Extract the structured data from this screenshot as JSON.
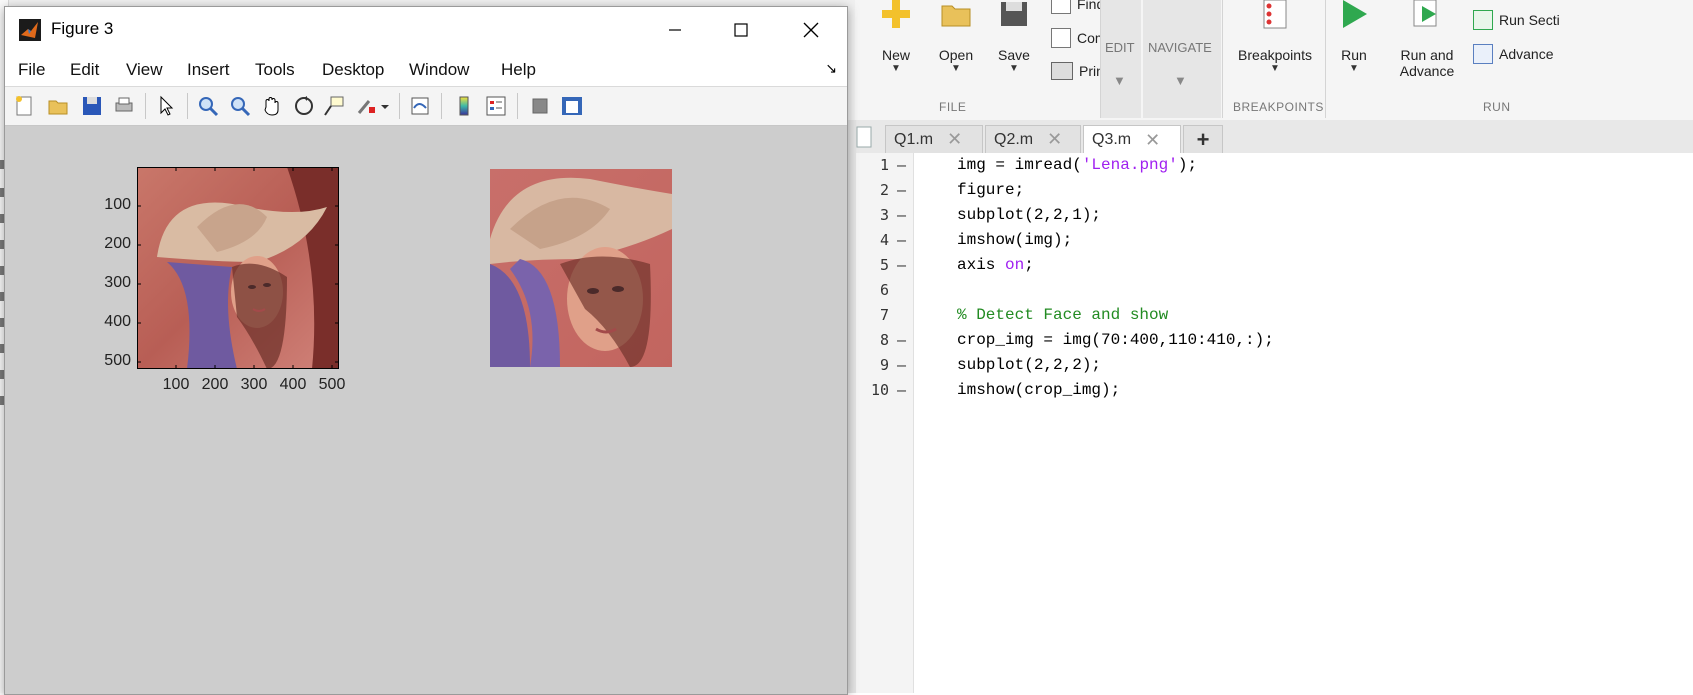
{
  "figure": {
    "title": "Figure 3",
    "menus": [
      "File",
      "Edit",
      "View",
      "Insert",
      "Tools",
      "Desktop",
      "Window",
      "Help"
    ],
    "toolbar_icons": [
      "new-figure-icon",
      "open-file-icon",
      "save-icon",
      "print-icon",
      "pointer-icon",
      "zoom-in-icon",
      "zoom-out-icon",
      "pan-hand-icon",
      "rotate-3d-icon",
      "data-cursor-icon",
      "brush-icon",
      "link-plot-icon",
      "colorbar-icon",
      "legend-icon",
      "hide-plot-tools-icon",
      "show-plot-tools-icon"
    ],
    "subplot1": {
      "yticks": [
        "100",
        "200",
        "300",
        "400",
        "500"
      ],
      "xticks": [
        "100",
        "200",
        "300",
        "400",
        "500"
      ]
    }
  },
  "toolstrip": {
    "new_label": "New",
    "open_label": "Open",
    "save_label": "Save",
    "find_files_label": "Find Files",
    "compare_label": "Compare",
    "print_label": "Print",
    "edit_label": "EDIT",
    "navigate_label": "NAVIGATE",
    "breakpoints_label": "Breakpoints",
    "run_label": "Run",
    "run_advance_label_1": "Run and",
    "run_advance_label_2": "Advance",
    "run_section_label": "Run Secti",
    "advance_label": "Advance",
    "sections": {
      "file": "FILE",
      "breakpoints": "BREAKPOINTS",
      "run": "RUN"
    }
  },
  "editor": {
    "tabs": [
      {
        "label": "Q1.m",
        "active": false
      },
      {
        "label": "Q2.m",
        "active": false
      },
      {
        "label": "Q3.m",
        "active": true
      }
    ],
    "add_tab": "+",
    "lines": [
      {
        "n": "1",
        "dash": "–"
      },
      {
        "n": "2",
        "dash": "–"
      },
      {
        "n": "3",
        "dash": "–"
      },
      {
        "n": "4",
        "dash": "–"
      },
      {
        "n": "5",
        "dash": "–"
      },
      {
        "n": "6",
        "dash": ""
      },
      {
        "n": "7",
        "dash": ""
      },
      {
        "n": "8",
        "dash": "–"
      },
      {
        "n": "9",
        "dash": "–"
      },
      {
        "n": "10",
        "dash": "–"
      }
    ],
    "code": {
      "l1a": "img = imread(",
      "l1s": "'Lena.png'",
      "l1b": ");",
      "l2": "figure;",
      "l3": "subplot(2,2,1);",
      "l4": "imshow(img);",
      "l5a": "axis ",
      "l5k": "on",
      "l5b": ";",
      "l7": "% Detect Face and show",
      "l8": "crop_img = img(70:400,110:410,:);",
      "l9": "subplot(2,2,2);",
      "l10": "imshow(crop_img);"
    }
  },
  "colors": {
    "string": "#a020f0",
    "comment": "#228b22",
    "run_green": "#2fa84f"
  }
}
